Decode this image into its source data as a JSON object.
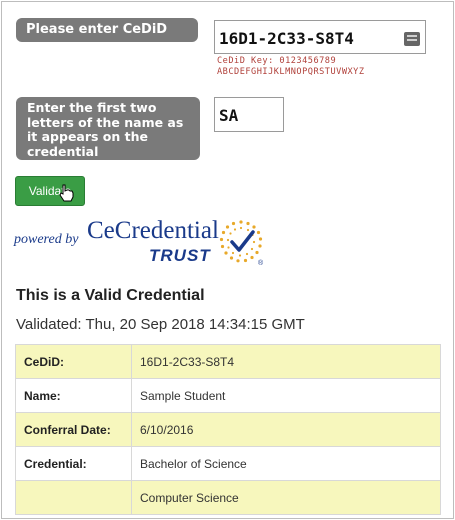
{
  "form": {
    "cedid_label": "Please enter CeDiD",
    "cedid_value": "16D1-2C33-S8T4",
    "key_line1": "CeDiD Key: 0123456789",
    "key_line2": "ABCDEFGHIJKLMNOPQRSTUVWXYZ",
    "name_label": "Enter the first two letters of the name as it appears on the credential",
    "name_value": "SA",
    "validate_label": "Validate"
  },
  "logo": {
    "powered_by": "powered by",
    "name": "CeCredential",
    "sub": "TRUST",
    "registered": "®"
  },
  "result": {
    "title": "This is a Valid Credential",
    "validated": "Validated: Thu, 20 Sep 2018 14:34:15 GMT",
    "rows": [
      {
        "key": "CeDiD:",
        "value": "16D1-2C33-S8T4"
      },
      {
        "key": "Name:",
        "value": "Sample Student"
      },
      {
        "key": "Conferral Date:",
        "value": "6/10/2016"
      },
      {
        "key": "Credential:",
        "value": "Bachelor of Science"
      },
      {
        "key": "",
        "value": "Computer Science"
      }
    ]
  },
  "colors": {
    "label_bg": "#7a7a7a",
    "button": "#3a9d45",
    "brand_blue": "#1a3a8a",
    "row_highlight": "#f7f7bd",
    "key_red": "#b0403a"
  },
  "icons": [
    "keyboard-icon",
    "pointer-cursor-icon",
    "checkmark-seal-icon"
  ]
}
